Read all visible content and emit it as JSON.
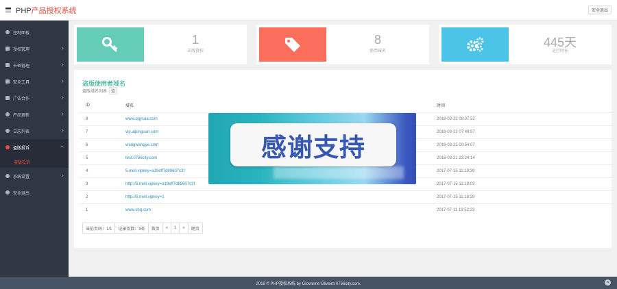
{
  "header": {
    "brand_prefix": "PHP",
    "brand_accent": "产品授权系统",
    "logout_label": "安全退出"
  },
  "sidebar": {
    "items": [
      {
        "label": "控制面板",
        "icon": "dashboard-icon"
      },
      {
        "label": "授权管理",
        "icon": "key-icon"
      },
      {
        "label": "卡密管理",
        "icon": "card-icon"
      },
      {
        "label": "安全工具",
        "icon": "shield-icon"
      },
      {
        "label": "广告合作",
        "icon": "megaphone-icon"
      },
      {
        "label": "产品更新",
        "icon": "cloud-icon"
      },
      {
        "label": "日志列表",
        "icon": "log-icon"
      },
      {
        "label": "盗版投诉",
        "icon": "warning-icon"
      },
      {
        "label": "系统设置",
        "icon": "gear-icon"
      },
      {
        "label": "安全退出",
        "icon": "power-icon"
      }
    ],
    "active_sub": "盗版投诉"
  },
  "stats": [
    {
      "value": "1",
      "label": "正版授权",
      "icon": "key-icon",
      "color": "#66cdb8"
    },
    {
      "value": "8",
      "label": "使用域名",
      "icon": "tag-icon",
      "color": "#fa6e5b"
    },
    {
      "value": "445天",
      "label": "运行时长",
      "icon": "gears-icon",
      "color": "#4cc4e8"
    }
  ],
  "panel": {
    "title": "盗版使用者域名",
    "subtitle": "盗版域名列表",
    "subtitle_tag": "盗",
    "columns": [
      "ID",
      "域名",
      "时间"
    ],
    "rows": [
      {
        "id": "8",
        "domain": "www.qqysaa.com",
        "time": "2018-03-22 08:37:52"
      },
      {
        "id": "7",
        "domain": "vip.aipinguan.com",
        "time": "2018-03-22 07:49:57"
      },
      {
        "id": "6",
        "domain": "wangwangye.com",
        "time": "2018-03-22 00:54:07"
      },
      {
        "id": "5",
        "domain": "test.0766city.com",
        "time": "2018-03-21 23:24:14"
      },
      {
        "id": "4",
        "domain": "5.meli.vipkey=a19eff7d89607c3f",
        "time": "2017-07-15 11:19:39"
      },
      {
        "id": "3",
        "domain": "http://5.meli.vipkey=a19eff7d89607c3f",
        "time": "2017-07-15 11:19:03"
      },
      {
        "id": "2",
        "domain": "http://5.meli.vipkey=1",
        "time": "2017-07-15 11:18:29"
      },
      {
        "id": "1",
        "domain": "www.shq.com",
        "time": "2017-07-11 19:52:23"
      }
    ],
    "pager": {
      "page_info": "当前页码：1/1",
      "record_count": "记录条数：8条",
      "first": "首页",
      "prev": "«",
      "current": "1",
      "next": "»",
      "last": "尾页"
    }
  },
  "banner": {
    "text": "感谢支持"
  },
  "footer": {
    "text": "2018 © PHP授权系统 by Giovanne Oliveira 0766city.com.",
    "close_glyph": "×"
  }
}
